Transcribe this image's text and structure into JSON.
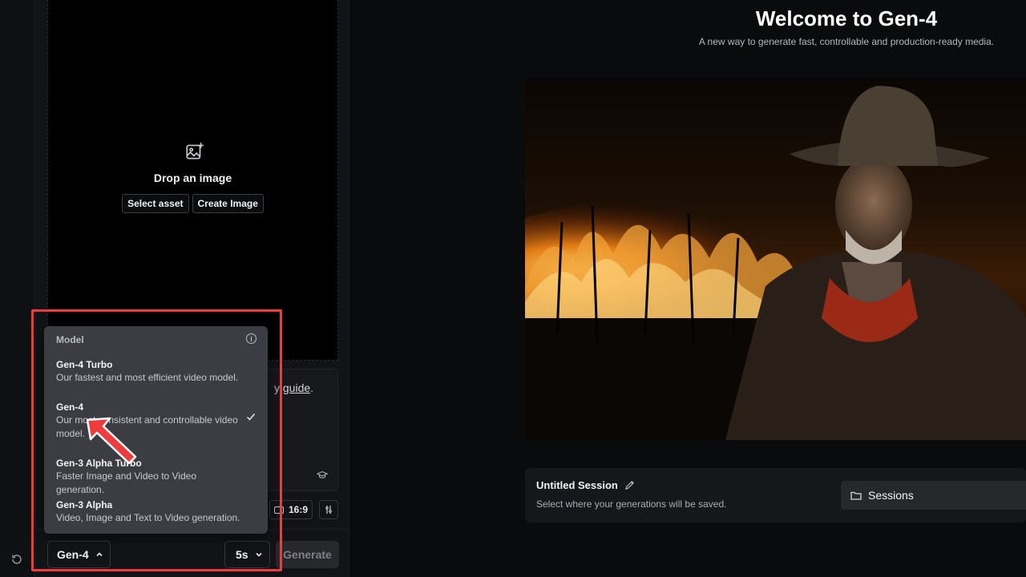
{
  "left_panel": {
    "drop_title": "Drop an image",
    "select_asset": "Select asset",
    "create_image": "Create Image",
    "prompt_partial": "y",
    "prompt_link": "guide",
    "prompt_after": ".",
    "aspect_ratio": "16:9"
  },
  "bottom_bar": {
    "model_label": "Gen-4",
    "duration_label": "5s",
    "generate_label": "Generate"
  },
  "model_dropdown": {
    "header": "Model",
    "selected": "Gen-4",
    "items": [
      {
        "title": "Gen-4 Turbo",
        "desc": "Our fastest and most efficient video model."
      },
      {
        "title": "Gen-4",
        "desc": "Our most consistent and controllable video model."
      },
      {
        "title": "Gen-3 Alpha Turbo",
        "desc": "Faster Image and Video to Video generation."
      },
      {
        "title": "Gen-3 Alpha",
        "desc": "Video, Image and Text to Video generation."
      }
    ]
  },
  "main": {
    "title": "Welcome to Gen-4",
    "subtitle": "A new way to generate fast, controllable and production-ready media."
  },
  "session": {
    "title": "Untitled Session",
    "subtitle": "Select where your generations will be saved.",
    "sessions_button": "Sessions"
  },
  "colors": {
    "annotation": "#ef3b3b",
    "dropdown_bg": "#3b3d42",
    "panel_bg": "#121316"
  }
}
